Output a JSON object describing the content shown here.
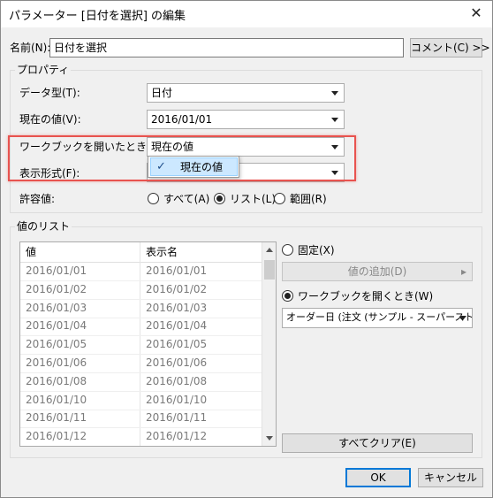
{
  "window": {
    "title": "パラメーター [日付を選択] の編集",
    "close_glyph": "✕"
  },
  "name_row": {
    "label": "名前(N):",
    "value": "日付を選択",
    "comment_button": "コメント(C) >>"
  },
  "properties": {
    "group_title": "プロパティ",
    "data_type": {
      "label": "データ型(T):",
      "value": "日付"
    },
    "current_value": {
      "label": "現在の値(V):",
      "value": "2016/01/01"
    },
    "on_workbook_open": {
      "label": "ワークブックを開いたときの値(O):",
      "value": "現在の値",
      "dropdown_options": [
        {
          "label": "現在の値",
          "checked": true,
          "check_glyph": "✓"
        }
      ]
    },
    "display_format": {
      "label": "表示形式(F):",
      "value": ""
    },
    "allowable_values": {
      "label": "許容値:",
      "options": [
        {
          "label": "すべて(A)",
          "selected": false
        },
        {
          "label": "リスト(L)",
          "selected": true
        },
        {
          "label": "範囲(R)",
          "selected": false
        }
      ]
    }
  },
  "value_list": {
    "group_title": "値のリスト",
    "columns": [
      "値",
      "表示名"
    ],
    "rows": [
      [
        "2016/01/01",
        "2016/01/01"
      ],
      [
        "2016/01/02",
        "2016/01/02"
      ],
      [
        "2016/01/03",
        "2016/01/03"
      ],
      [
        "2016/01/04",
        "2016/01/04"
      ],
      [
        "2016/01/05",
        "2016/01/05"
      ],
      [
        "2016/01/06",
        "2016/01/06"
      ],
      [
        "2016/01/08",
        "2016/01/08"
      ],
      [
        "2016/01/10",
        "2016/01/10"
      ],
      [
        "2016/01/11",
        "2016/01/11"
      ],
      [
        "2016/01/12",
        "2016/01/12"
      ]
    ],
    "fixed_radio": {
      "label": "固定(X)",
      "selected": false
    },
    "add_value_button": {
      "label": "値の追加(D)",
      "arrow": "▸"
    },
    "on_open_radio": {
      "label": "ワークブックを開くとき(W)",
      "selected": true
    },
    "field_select": {
      "value": "オーダー日 (注文 (サンプル - スーパーストア))"
    },
    "clear_all_button": "すべてクリア(E)"
  },
  "footer": {
    "ok": "OK",
    "cancel": "キャンセル"
  },
  "colors": {
    "highlight": "#e8534f",
    "selection": "#cce8ff",
    "accent": "#0078d7"
  }
}
